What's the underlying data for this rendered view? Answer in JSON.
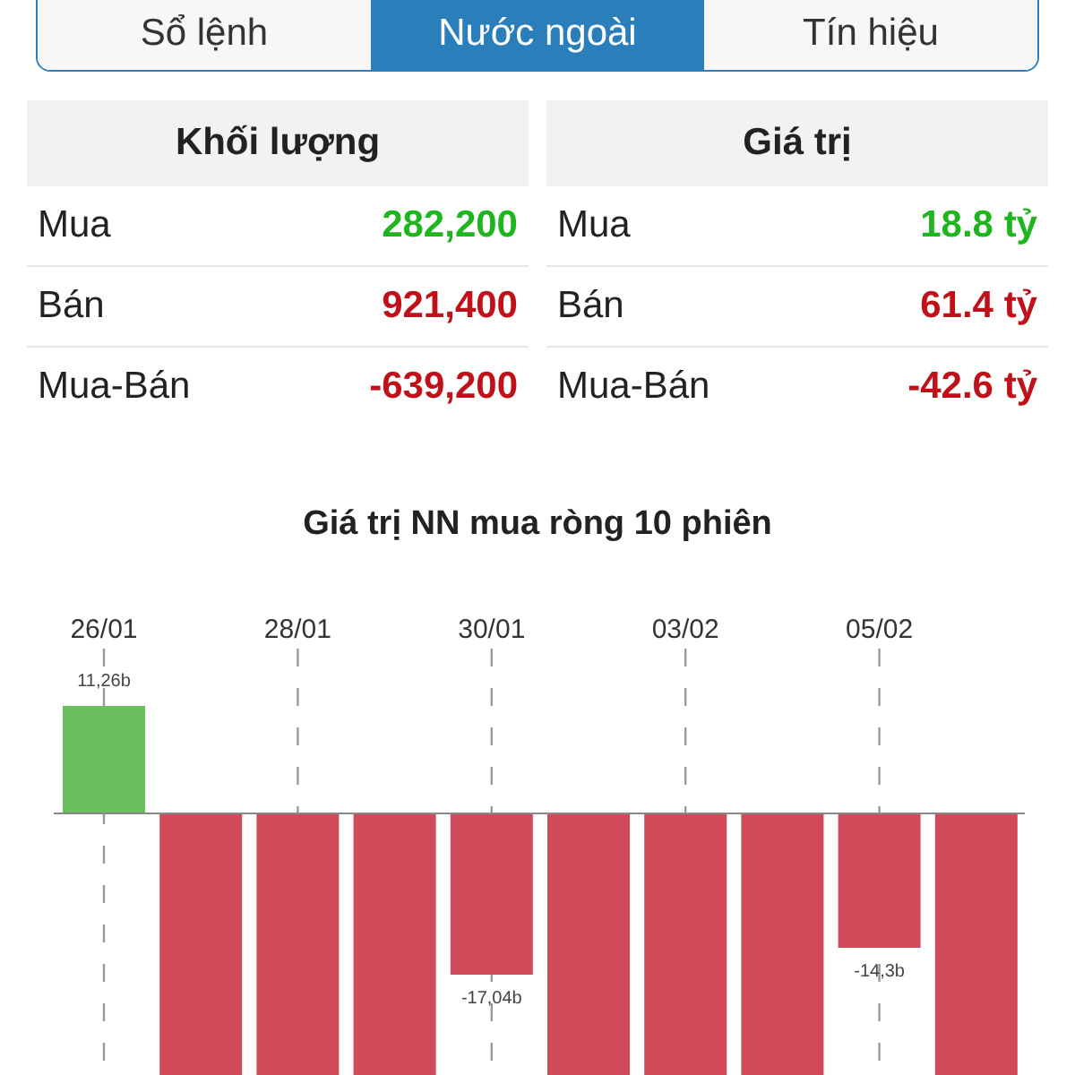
{
  "tabs": [
    {
      "label": "Sổ lệnh",
      "selected": false
    },
    {
      "label": "Nước ngoài",
      "selected": true
    },
    {
      "label": "Tín hiệu",
      "selected": false
    }
  ],
  "panels": [
    {
      "title": "Khối lượng",
      "rows": [
        {
          "label": "Mua",
          "value": "282,200",
          "color": "#1fb51f"
        },
        {
          "label": "Bán",
          "value": "921,400",
          "color": "#c0101a"
        },
        {
          "label": "Mua-Bán",
          "value": "-639,200",
          "color": "#c0101a"
        }
      ]
    },
    {
      "title": "Giá trị",
      "rows": [
        {
          "label": "Mua",
          "value": "18.8 tỷ",
          "color": "#1fb51f"
        },
        {
          "label": "Bán",
          "value": "61.4 tỷ",
          "color": "#c0101a"
        },
        {
          "label": "Mua-Bán",
          "value": "-42.6 tỷ",
          "color": "#c0101a"
        }
      ]
    }
  ],
  "chart": {
    "title": "Giá trị NN mua ròng 10 phiên",
    "bars": [
      {
        "kind": "positive",
        "date": "26/01",
        "label": "11,26b"
      },
      {
        "kind": "negative"
      },
      {
        "kind": "negative",
        "date": "28/01"
      },
      {
        "kind": "negative"
      },
      {
        "kind": "negative",
        "date": "30/01",
        "label": "-17,04b"
      },
      {
        "kind": "negative"
      },
      {
        "kind": "negative",
        "date": "03/02"
      },
      {
        "kind": "negative"
      },
      {
        "kind": "negative",
        "date": "05/02",
        "label": "-14,3b"
      },
      {
        "kind": "negative"
      }
    ]
  }
}
